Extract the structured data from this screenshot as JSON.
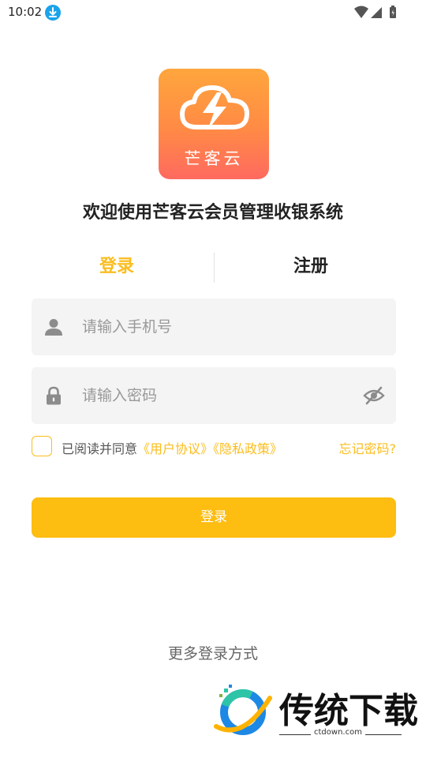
{
  "status_bar": {
    "time": "10:02"
  },
  "app": {
    "logo_text": "芒客云",
    "welcome": "欢迎使用芒客云会员管理收银系统"
  },
  "tabs": {
    "login": "登录",
    "register": "注册"
  },
  "phone_field": {
    "placeholder": "请输入手机号",
    "value": ""
  },
  "password_field": {
    "placeholder": "请输入密码",
    "value": ""
  },
  "agreement": {
    "prefix": "已阅读并同意",
    "user_agreement": "《用户协议》",
    "privacy_policy": "《隐私政策》",
    "forgot_password": "忘记密码?"
  },
  "login_button": "登录",
  "more_login": "更多登录方式",
  "watermark": {
    "title": "传统下载",
    "subtitle": "ctdown.com"
  },
  "colors": {
    "accent": "#fbbd1e",
    "button": "#fdbd11",
    "field_bg": "#f4f4f4",
    "logo_top": "#ffa63d",
    "logo_bottom": "#ff6a60"
  }
}
